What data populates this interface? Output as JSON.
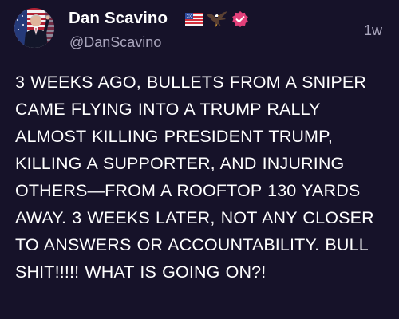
{
  "post": {
    "author": {
      "name": "Dan Scavino",
      "handle": "@DanScavino",
      "badges": [
        "us-flag-icon",
        "eagle-icon",
        "verified-badge-icon"
      ]
    },
    "timestamp": "1w",
    "text": "3 WEEKS AGO, BULLETS FROM A SNIPER CAME FLYING INTO A TRUMP RALLY ALMOST KILLING PRESIDENT TRUMP, KILLING A SUPPORTER, AND INJURING OTHERS—FROM A ROOFTOP 130 YARDS AWAY. 3 WEEKS LATER, NOT ANY CLOSER TO ANSWERS OR ACCOUNTABILITY. BULL SHIT!!!!! WHAT IS GOING ON?!"
  },
  "colors": {
    "background": "#161229",
    "text": "#ffffff",
    "secondary_text": "#aaa6bd",
    "verified_badge": "#e2407a"
  }
}
